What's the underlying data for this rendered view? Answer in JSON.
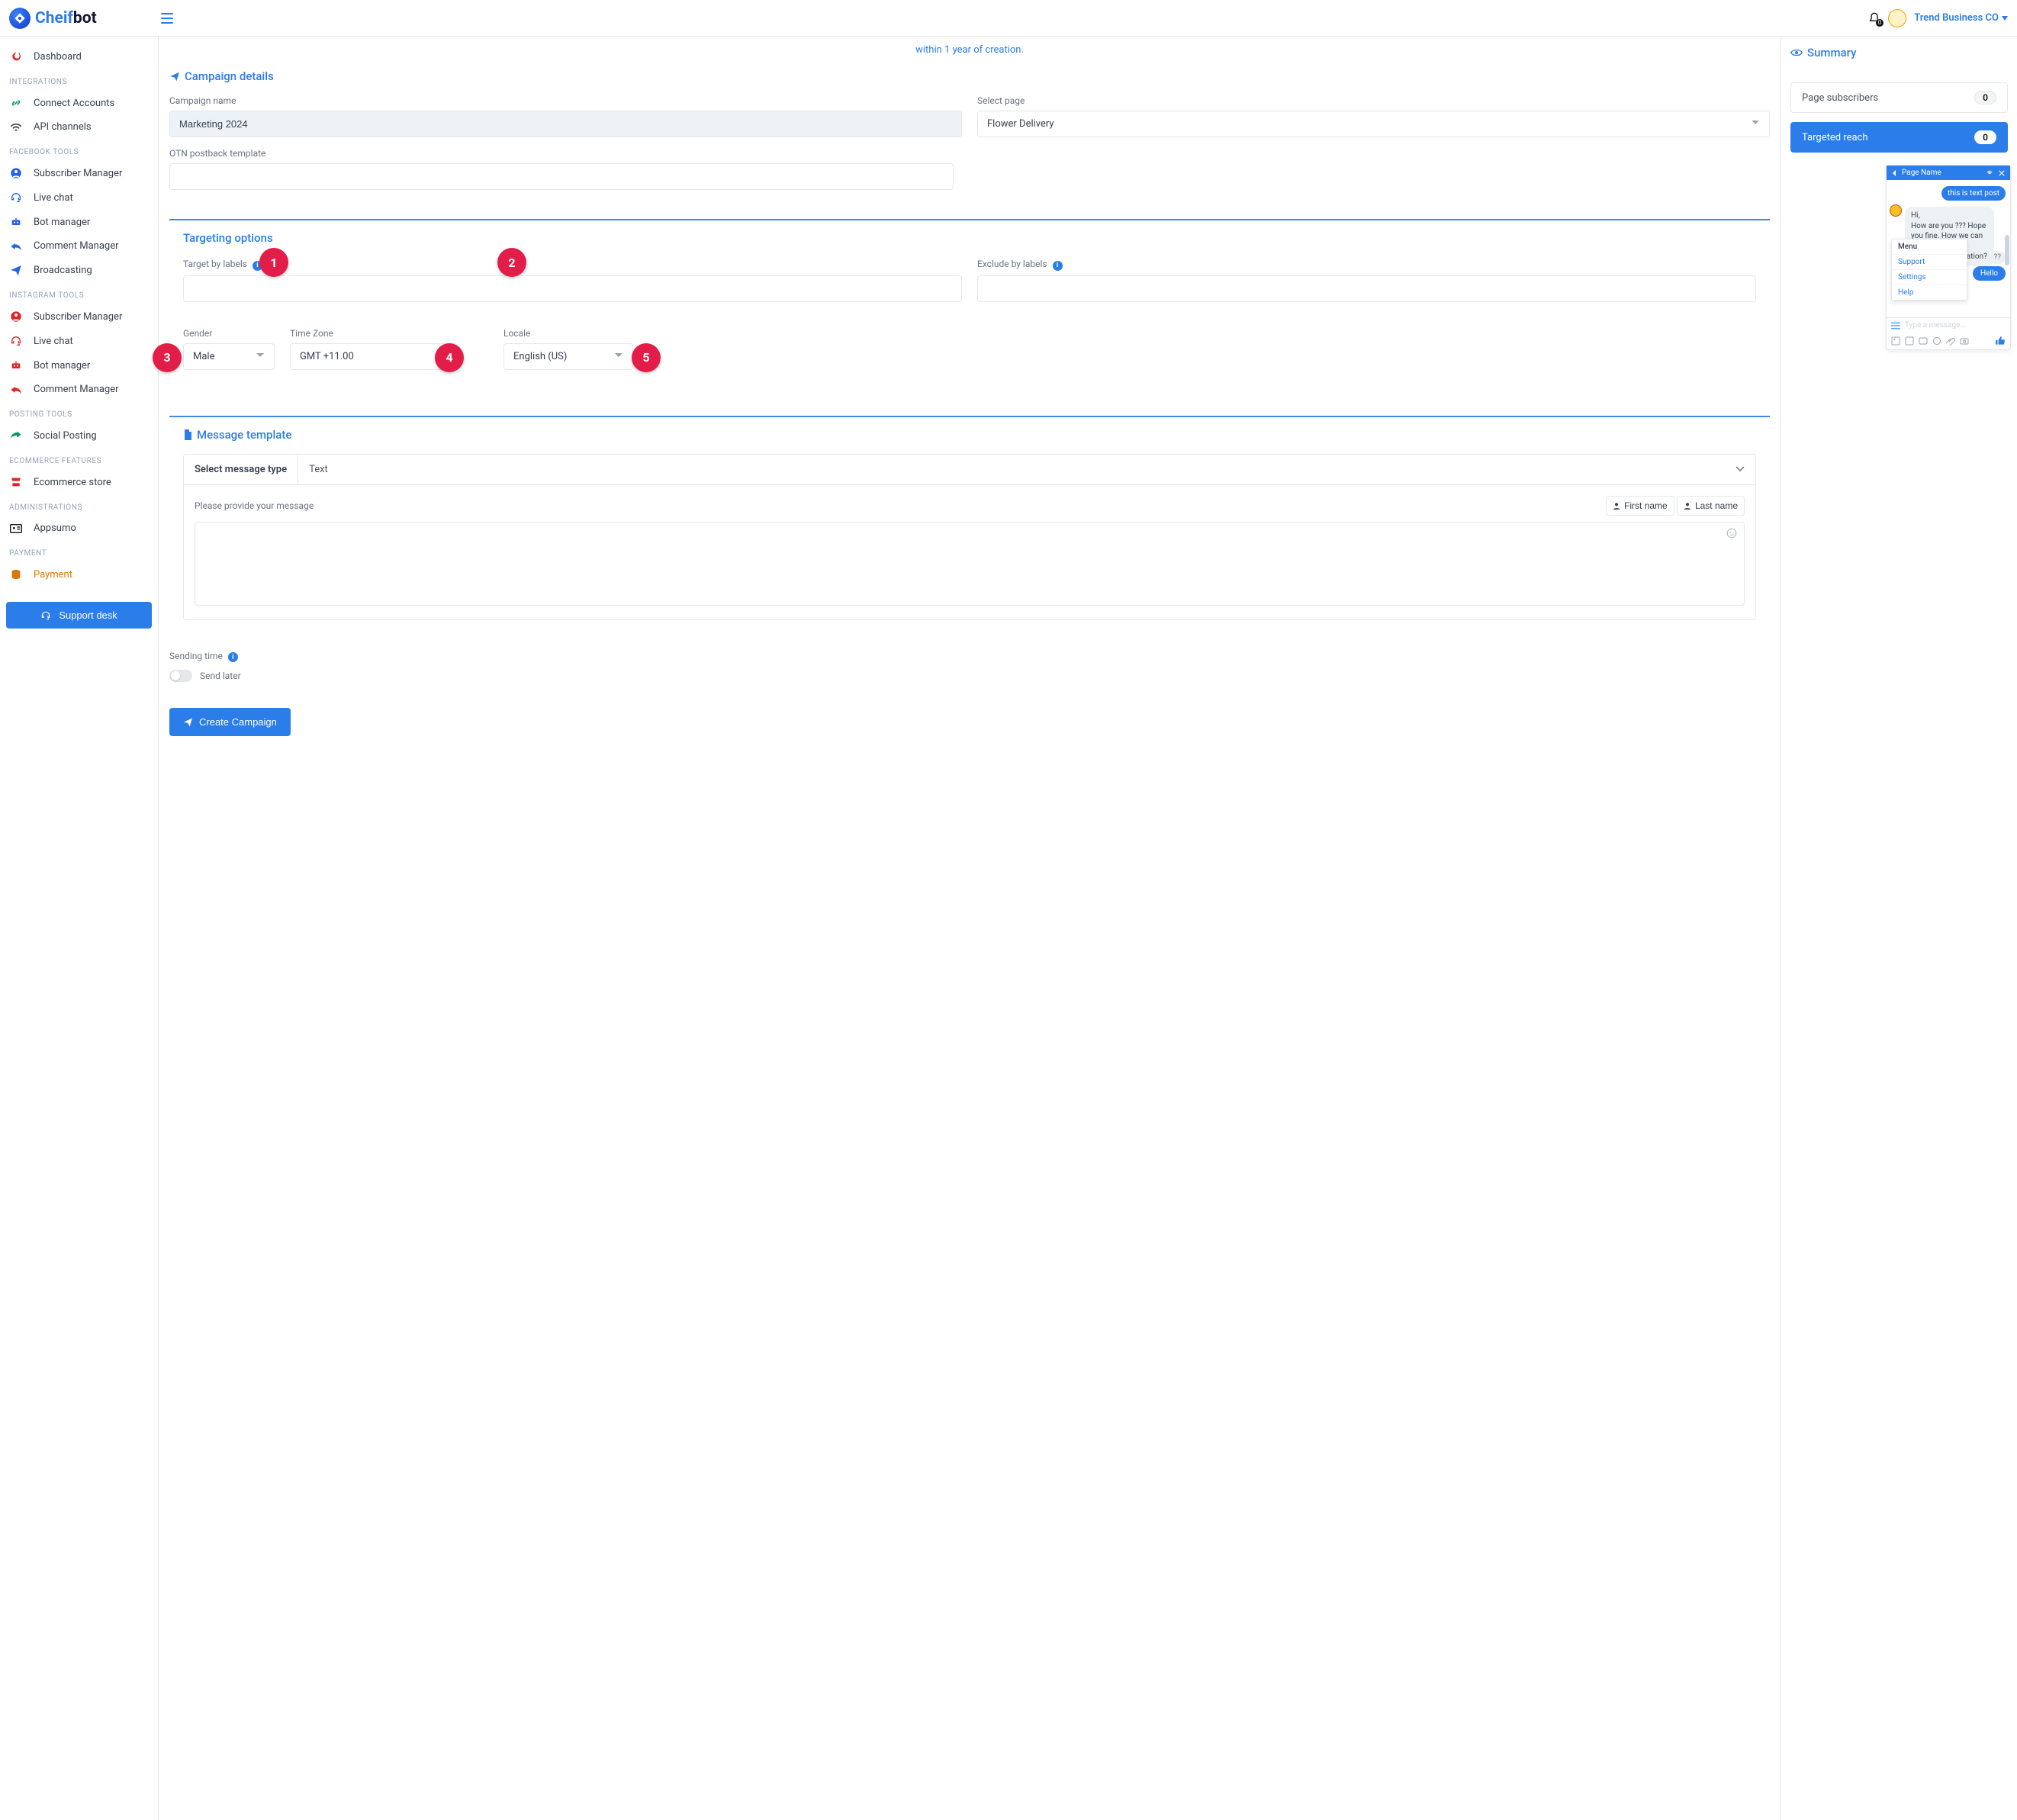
{
  "brand": {
    "part1": "Cheif",
    "part2": "bot"
  },
  "topbar": {
    "notification_count": "0",
    "account_name": "Trend Business CO"
  },
  "sidebar": {
    "dashboard": "Dashboard",
    "sections": {
      "integrations": "INTEGRATIONS",
      "fb": "FACEBOOK TOOLS",
      "ig": "INSTAGRAM TOOLS",
      "posting": "POSTING TOOLS",
      "ecom": "ECOMMERCE FEATURES",
      "admin": "ADMINISTRATIONS",
      "payment": "PAYMENT"
    },
    "items": {
      "connect": "Connect Accounts",
      "api": "API channels",
      "sub_mgr": "Subscriber Manager",
      "live_chat": "Live chat",
      "bot_mgr": "Bot manager",
      "comment_mgr": "Comment Manager",
      "broadcasting": "Broadcasting",
      "ig_sub_mgr": "Subscriber Manager",
      "ig_live_chat": "Live chat",
      "ig_bot_mgr": "Bot manager",
      "ig_comment_mgr": "Comment Manager",
      "social_posting": "Social Posting",
      "ecom_store": "Ecommerce store",
      "appsumo": "Appsumo",
      "payment": "Payment"
    },
    "support": "Support desk"
  },
  "note": "within 1 year of creation.",
  "campaign": {
    "section_title": "Campaign details",
    "name_label": "Campaign name",
    "name_value": "Marketing 2024",
    "page_label": "Select page",
    "page_value": "Flower Delivery",
    "otn_label": "OTN postback template",
    "otn_value": ""
  },
  "targeting": {
    "title": "Targeting options",
    "target_label": "Target by labels",
    "exclude_label": "Exclude by labels",
    "gender_label": "Gender",
    "gender_value": "Male",
    "tz_label": "Time Zone",
    "tz_value": "GMT +11.00",
    "locale_label": "Locale",
    "locale_value": "English (US)",
    "marker1": "1",
    "marker2": "2",
    "marker3": "3",
    "marker4": "4",
    "marker5": "5"
  },
  "message": {
    "title": "Message template",
    "type_label": "Select message type",
    "type_value": "Text",
    "provide_label": "Please provide your message",
    "first_name": "First name",
    "last_name": "Last name"
  },
  "sending": {
    "label": "Sending time",
    "toggle_label": "Send later"
  },
  "create_btn": "Create Campaign",
  "summary": {
    "title": "Summary",
    "subs_label": "Page subscribers",
    "subs_value": "0",
    "reach_label": "Targeted reach",
    "reach_value": "0"
  },
  "chat": {
    "header": "Page Name",
    "outgoing": "this is text post",
    "incoming": "Hi,\nHow are you ??? Hope you fine. How we can assist you by providing information?",
    "truncated": "??",
    "hello": "Hello",
    "menu": {
      "head": "Menu",
      "a": "Support",
      "b": "Settings",
      "c": "Help"
    },
    "placeholder": "Type a message..."
  }
}
